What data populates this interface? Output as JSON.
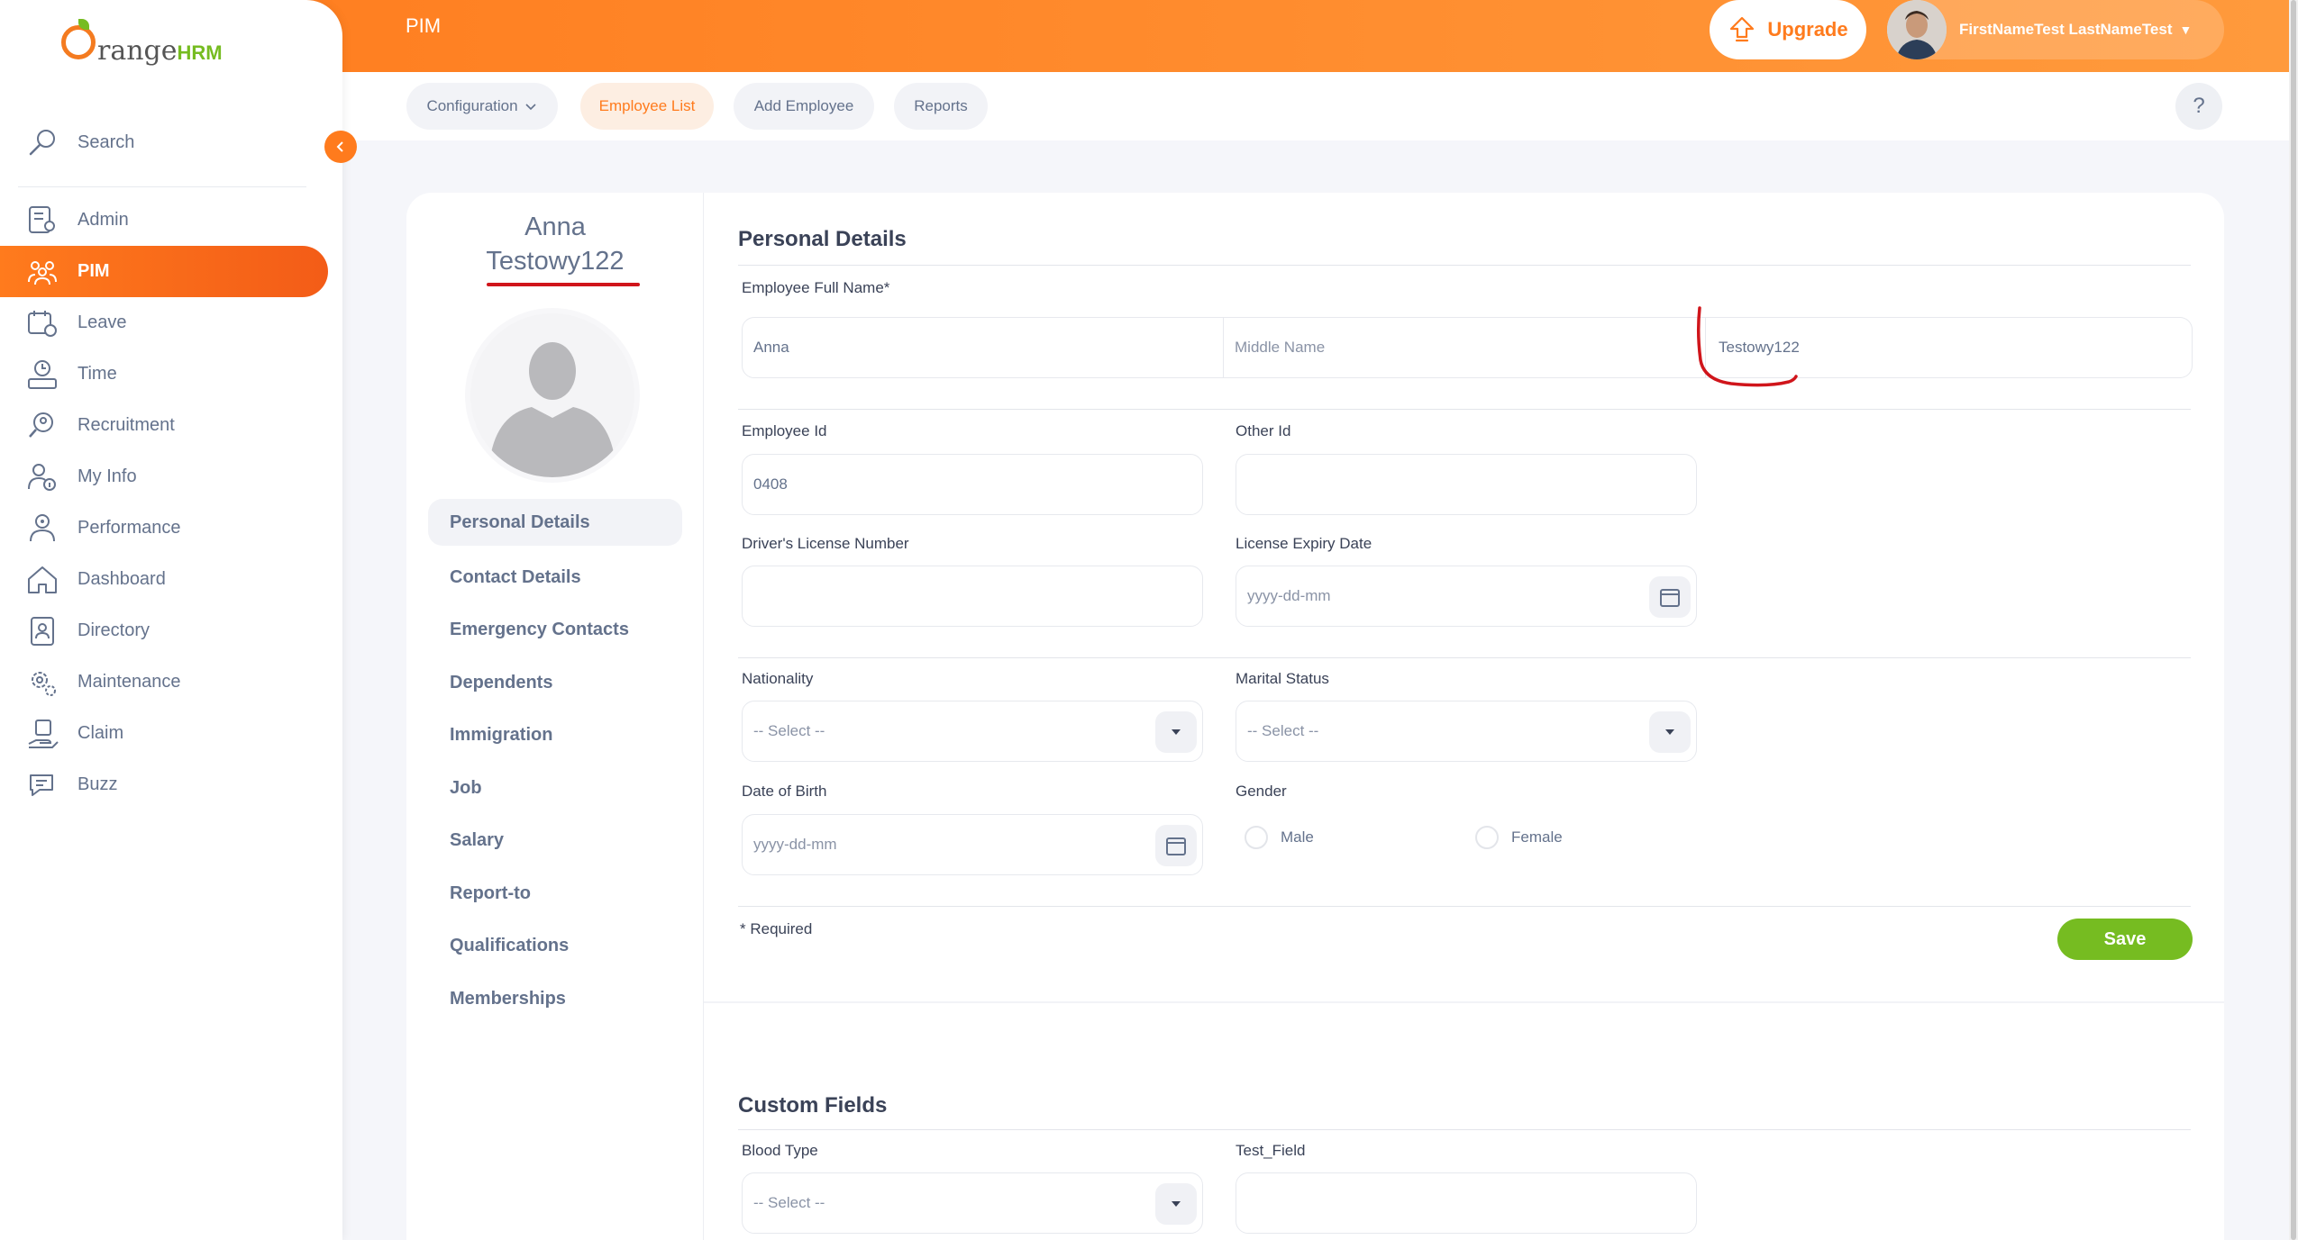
{
  "app": {
    "brand_main": "range",
    "brand_suffix": "HRM",
    "module_title": "PIM"
  },
  "header": {
    "upgrade_label": "Upgrade",
    "user_name": "FirstNameTest LastNameTest"
  },
  "sidebar": {
    "search_label": "Search",
    "items": [
      {
        "label": "Admin",
        "icon": "admin-icon"
      },
      {
        "label": "PIM",
        "icon": "pim-icon",
        "active": true
      },
      {
        "label": "Leave",
        "icon": "leave-icon"
      },
      {
        "label": "Time",
        "icon": "time-icon"
      },
      {
        "label": "Recruitment",
        "icon": "recruitment-icon"
      },
      {
        "label": "My Info",
        "icon": "my-info-icon"
      },
      {
        "label": "Performance",
        "icon": "performance-icon"
      },
      {
        "label": "Dashboard",
        "icon": "dashboard-icon"
      },
      {
        "label": "Directory",
        "icon": "directory-icon"
      },
      {
        "label": "Maintenance",
        "icon": "maintenance-icon"
      },
      {
        "label": "Claim",
        "icon": "claim-icon"
      },
      {
        "label": "Buzz",
        "icon": "buzz-icon"
      }
    ]
  },
  "subnav": {
    "configuration": "Configuration",
    "employee_list": "Employee List",
    "add_employee": "Add Employee",
    "reports": "Reports",
    "help": "?"
  },
  "profile": {
    "first_name": "Anna",
    "last_name": "Testowy122",
    "tabs": [
      "Personal Details",
      "Contact Details",
      "Emergency Contacts",
      "Dependents",
      "Immigration",
      "Job",
      "Salary",
      "Report-to",
      "Qualifications",
      "Memberships"
    ]
  },
  "personal_details": {
    "title": "Personal Details",
    "full_name_label": "Employee Full Name*",
    "first_name_value": "Anna",
    "middle_name_placeholder": "Middle Name",
    "last_name_value": "Testowy122",
    "employee_id_label": "Employee Id",
    "employee_id_value": "0408",
    "other_id_label": "Other Id",
    "license_label": "Driver's License Number",
    "license_expiry_label": "License Expiry Date",
    "date_placeholder": "yyyy-dd-mm",
    "nationality_label": "Nationality",
    "marital_label": "Marital Status",
    "select_placeholder": "-- Select --",
    "dob_label": "Date of Birth",
    "gender_label": "Gender",
    "gender_male": "Male",
    "gender_female": "Female",
    "required_note": "* Required",
    "save_label": "Save"
  },
  "custom_fields": {
    "title": "Custom Fields",
    "blood_type_label": "Blood Type",
    "test_field_label": "Test_Field",
    "select_placeholder": "-- Select --"
  },
  "colors": {
    "brand_orange": "#ff7b1d",
    "save_green": "#76bc21",
    "annotation_red": "#d0151b"
  }
}
